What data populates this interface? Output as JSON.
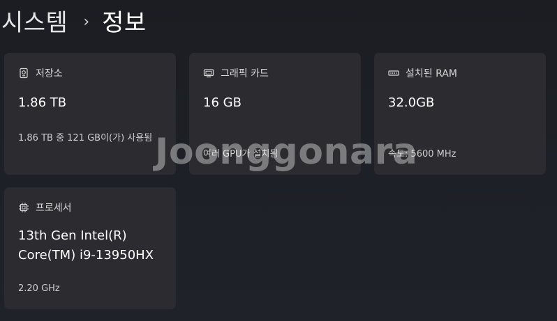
{
  "breadcrumb": {
    "parent": "시스템",
    "separator": "›",
    "current": "정보"
  },
  "cards": [
    {
      "icon": "storage-icon",
      "title": "저장소",
      "value": "1.86 TB",
      "sub": "1.86 TB 중 121 GB이(가) 사용됨"
    },
    {
      "icon": "display-icon",
      "title": "그래픽 카드",
      "value": "16 GB",
      "sub": "여러 GPU가 설치됨"
    },
    {
      "icon": "memory-icon",
      "title": "설치된 RAM",
      "value": "32.0GB",
      "sub": "속도: 5600 MHz"
    },
    {
      "icon": "processor-icon",
      "title": "프로세서",
      "value": "13th Gen Intel(R) Core(TM) i9-13950HX",
      "sub": "2.20 GHz"
    }
  ],
  "watermark": "Joonggonara"
}
